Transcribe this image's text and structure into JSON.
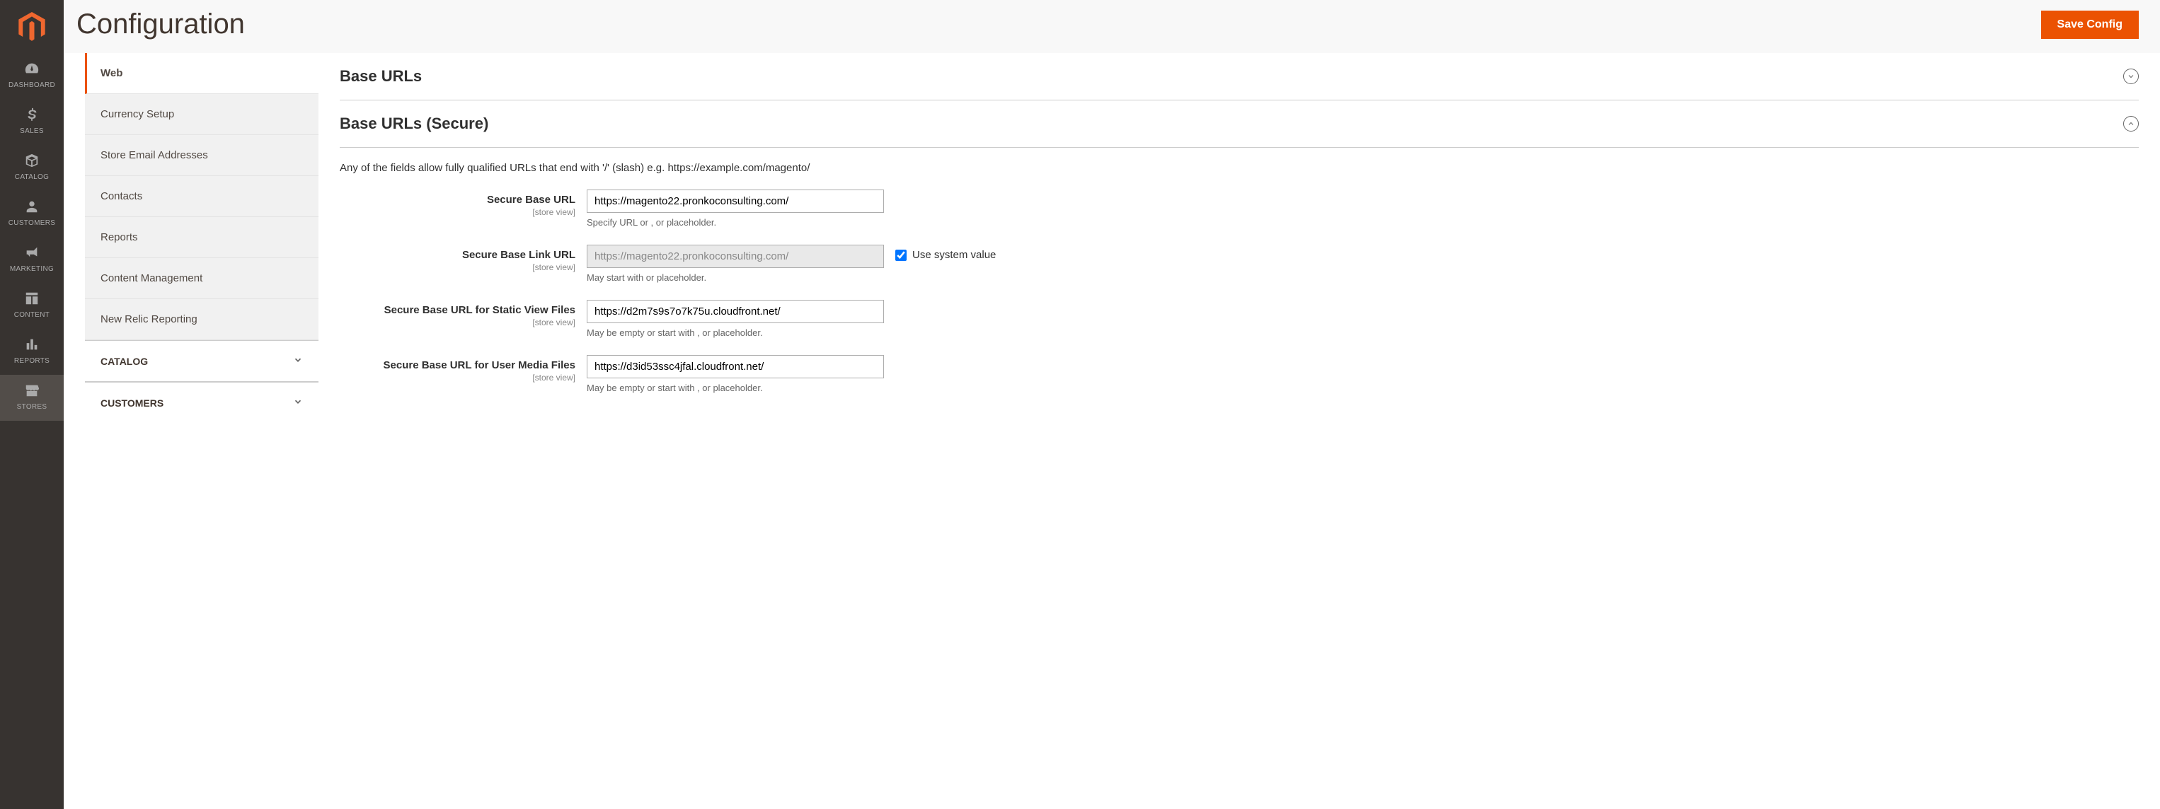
{
  "page": {
    "title": "Configuration",
    "save_label": "Save Config"
  },
  "nav": [
    {
      "id": "dashboard",
      "label": "DASHBOARD"
    },
    {
      "id": "sales",
      "label": "SALES"
    },
    {
      "id": "catalog",
      "label": "CATALOG"
    },
    {
      "id": "customers",
      "label": "CUSTOMERS"
    },
    {
      "id": "marketing",
      "label": "MARKETING"
    },
    {
      "id": "content",
      "label": "CONTENT"
    },
    {
      "id": "reports",
      "label": "REPORTS"
    },
    {
      "id": "stores",
      "label": "STORES",
      "active": true
    }
  ],
  "sidebar": {
    "tabs": [
      {
        "label": "Web",
        "active": true
      },
      {
        "label": "Currency Setup"
      },
      {
        "label": "Store Email Addresses"
      },
      {
        "label": "Contacts"
      },
      {
        "label": "Reports"
      },
      {
        "label": "Content Management"
      },
      {
        "label": "New Relic Reporting"
      }
    ],
    "groups": [
      {
        "label": "CATALOG"
      },
      {
        "label": "CUSTOMERS"
      }
    ]
  },
  "sections": {
    "base_urls": {
      "title": "Base URLs"
    },
    "base_urls_secure": {
      "title": "Base URLs (Secure)",
      "description": "Any of the fields allow fully qualified URLs that end with '/' (slash) e.g. https://example.com/magento/",
      "fields": [
        {
          "label": "Secure Base URL",
          "scope": "[store view]",
          "value": "https://magento22.pronkoconsulting.com/",
          "hint": "Specify URL or , or placeholder."
        },
        {
          "label": "Secure Base Link URL",
          "scope": "[store view]",
          "value": "https://magento22.pronkoconsulting.com/",
          "hint": "May start with or placeholder.",
          "disabled": true,
          "use_system": {
            "label": "Use system value",
            "checked": true
          }
        },
        {
          "label": "Secure Base URL for Static View Files",
          "scope": "[store view]",
          "value": "https://d2m7s9s7o7k75u.cloudfront.net/",
          "hint": "May be empty or start with , or placeholder."
        },
        {
          "label": "Secure Base URL for User Media Files",
          "scope": "[store view]",
          "value": "https://d3id53ssc4jfal.cloudfront.net/",
          "hint": "May be empty or start with , or placeholder."
        }
      ]
    }
  }
}
